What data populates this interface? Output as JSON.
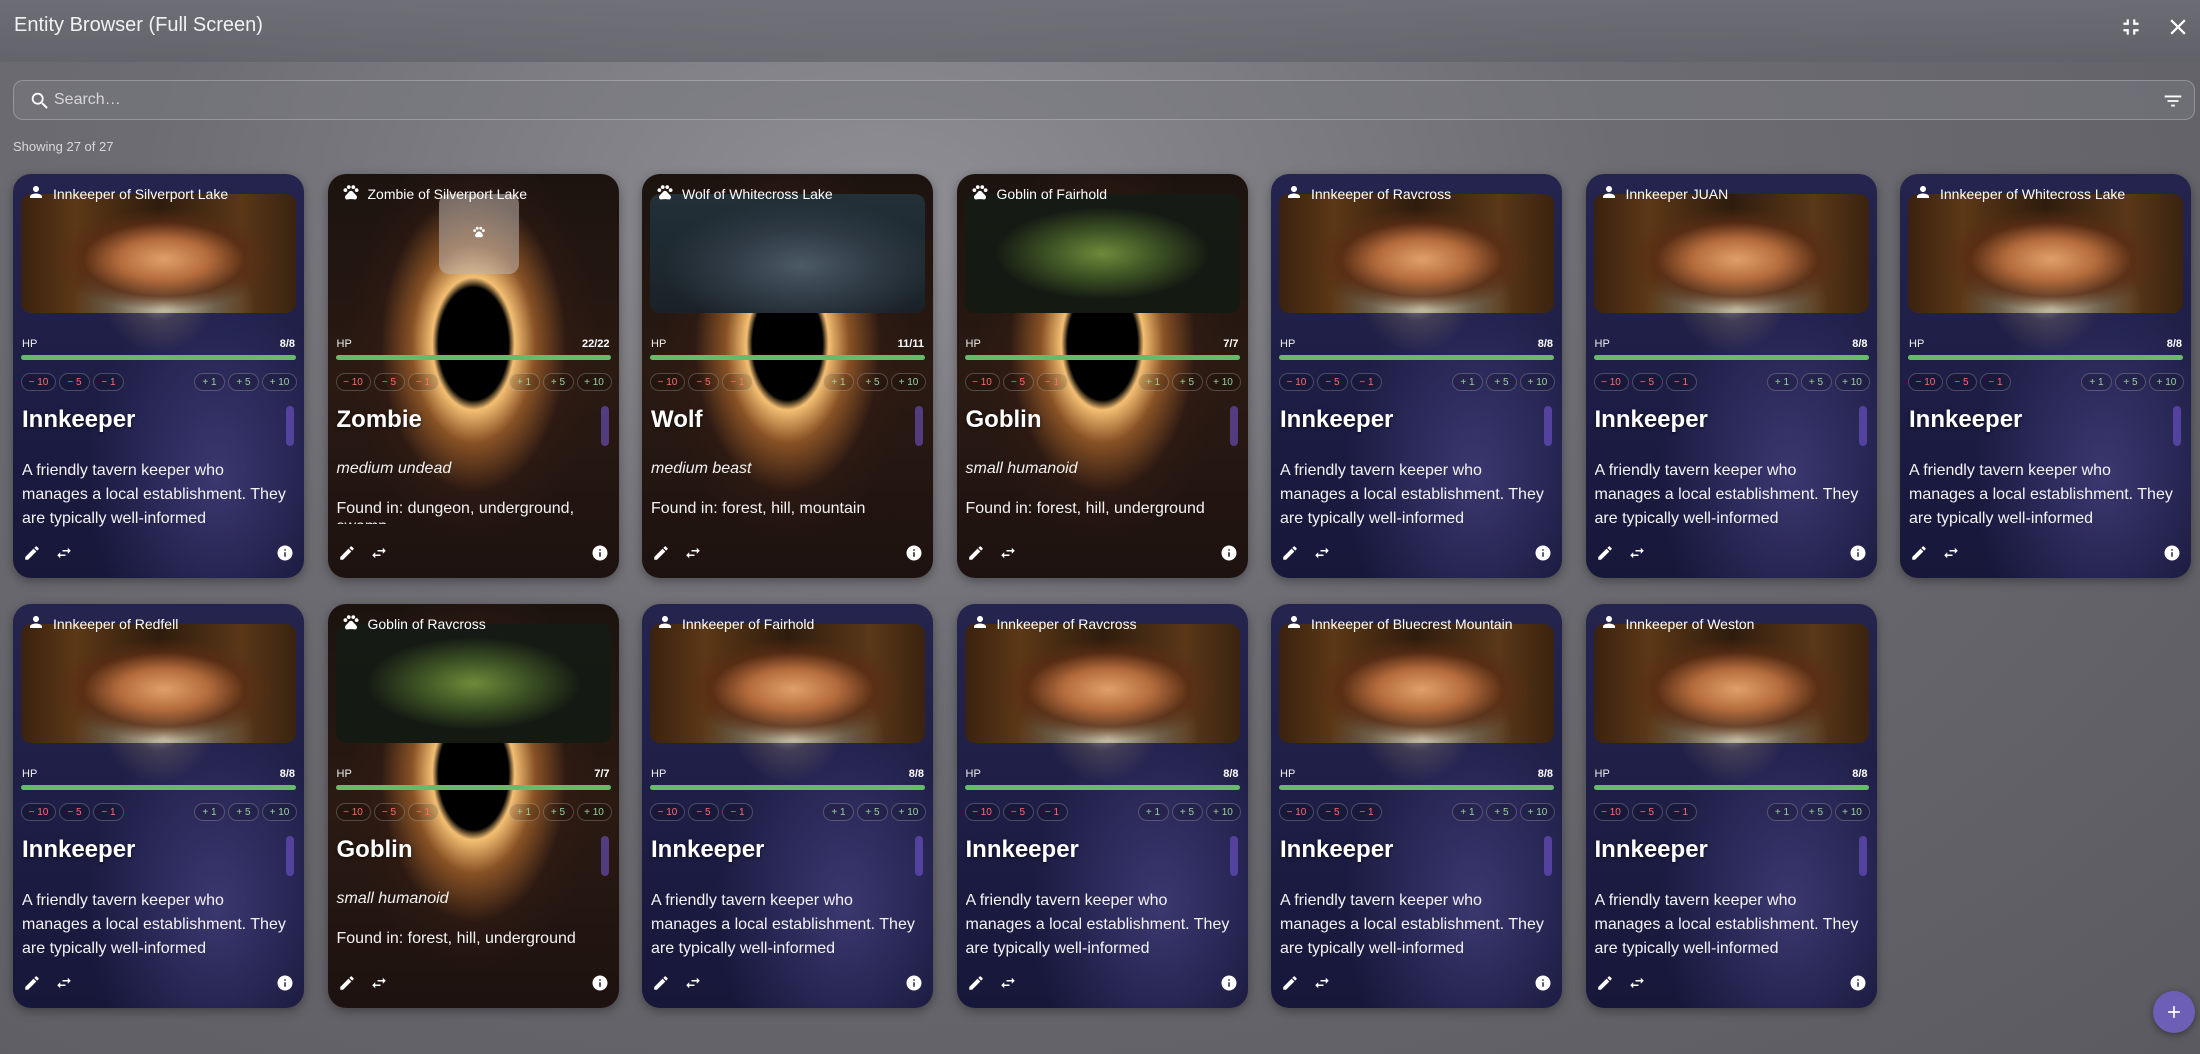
{
  "window": {
    "title": "Entity Browser (Full Screen)"
  },
  "toolbar": {
    "exit_fullscreen_icon": "fullscreen-exit-icon",
    "close_icon": "close-icon"
  },
  "search": {
    "placeholder": "Search…",
    "value": "",
    "filter_icon": "filter-icon"
  },
  "results": {
    "count_text": "Showing 27 of 27"
  },
  "hp_buttons": [
    "− 10",
    "− 5",
    "− 1",
    "+ 1",
    "+ 5",
    "+ 10"
  ],
  "labels": {
    "hp": "HP"
  },
  "cards": [
    {
      "title": "Innkeeper of Silverport Lake",
      "kind": "person",
      "portrait": "innkeeper",
      "hp": "8/8",
      "hp_fraction": 1,
      "name": "Innkeeper",
      "description": "A friendly tavern keeper who manages a local establishment. They are typically well-informed"
    },
    {
      "title": "Zombie of Silverport Lake",
      "kind": "beast",
      "portrait": "empty",
      "hp": "22/22",
      "hp_fraction": 1,
      "name": "Zombie",
      "type": "medium undead",
      "habitat": "Found in: dungeon, underground, swamp"
    },
    {
      "title": "Wolf of Whitecross Lake",
      "kind": "beast",
      "portrait": "wolf",
      "hp": "11/11",
      "hp_fraction": 1,
      "name": "Wolf",
      "type": "medium beast",
      "habitat": "Found in: forest, hill, mountain"
    },
    {
      "title": "Goblin of Fairhold",
      "kind": "beast",
      "portrait": "goblin",
      "hp": "7/7",
      "hp_fraction": 1,
      "name": "Goblin",
      "type": "small humanoid",
      "habitat": "Found in: forest, hill, underground"
    },
    {
      "title": "Innkeeper of Ravcross",
      "kind": "person",
      "portrait": "innkeeper",
      "hp": "8/8",
      "hp_fraction": 1,
      "name": "Innkeeper",
      "description": "A friendly tavern keeper who manages a local establishment. They are typically well-informed"
    },
    {
      "title": "Innkeeper JUAN",
      "kind": "person",
      "portrait": "innkeeper",
      "hp": "8/8",
      "hp_fraction": 1,
      "name": "Innkeeper",
      "description": "A friendly tavern keeper who manages a local establishment. They are typically well-informed"
    },
    {
      "title": "Innkeeper of Whitecross Lake",
      "kind": "person",
      "portrait": "innkeeper",
      "hp": "8/8",
      "hp_fraction": 1,
      "name": "Innkeeper",
      "description": "A friendly tavern keeper who manages a local establishment. They are typically well-informed"
    },
    {
      "title": "Innkeeper of Redfell",
      "kind": "person",
      "portrait": "innkeeper",
      "hp": "8/8",
      "hp_fraction": 1,
      "name": "Innkeeper",
      "description": "A friendly tavern keeper who manages a local establishment. They are typically well-informed"
    },
    {
      "title": "Goblin of Ravcross",
      "kind": "beast",
      "portrait": "goblin",
      "hp": "7/7",
      "hp_fraction": 1,
      "name": "Goblin",
      "type": "small humanoid",
      "habitat": "Found in: forest, hill, underground"
    },
    {
      "title": "Innkeeper of Fairhold",
      "kind": "person",
      "portrait": "innkeeper",
      "hp": "8/8",
      "hp_fraction": 1,
      "name": "Innkeeper",
      "description": "A friendly tavern keeper who manages a local establishment. They are typically well-informed"
    },
    {
      "title": "Innkeeper of Ravcross",
      "kind": "person",
      "portrait": "innkeeper",
      "hp": "8/8",
      "hp_fraction": 1,
      "name": "Innkeeper",
      "description": "A friendly tavern keeper who manages a local establishment. They are typically well-informed"
    },
    {
      "title": "Innkeeper of Bluecrest Mountain",
      "kind": "person",
      "portrait": "innkeeper",
      "hp": "8/8",
      "hp_fraction": 1,
      "name": "Innkeeper",
      "description": "A friendly tavern keeper who manages a local establishment. They are typically well-informed"
    },
    {
      "title": "Innkeeper of Weston",
      "kind": "person",
      "portrait": "innkeeper",
      "hp": "8/8",
      "hp_fraction": 1,
      "name": "Innkeeper",
      "description": "A friendly tavern keeper who manages a local establishment. They are typically well-informed"
    }
  ],
  "colors": {
    "hp_fill": "#66bb6a",
    "hp_negative": "#ff6b6b",
    "hp_positive": "#9bd09e",
    "fab": "#6d5fb5"
  },
  "fab": {
    "icon": "plus-icon"
  }
}
